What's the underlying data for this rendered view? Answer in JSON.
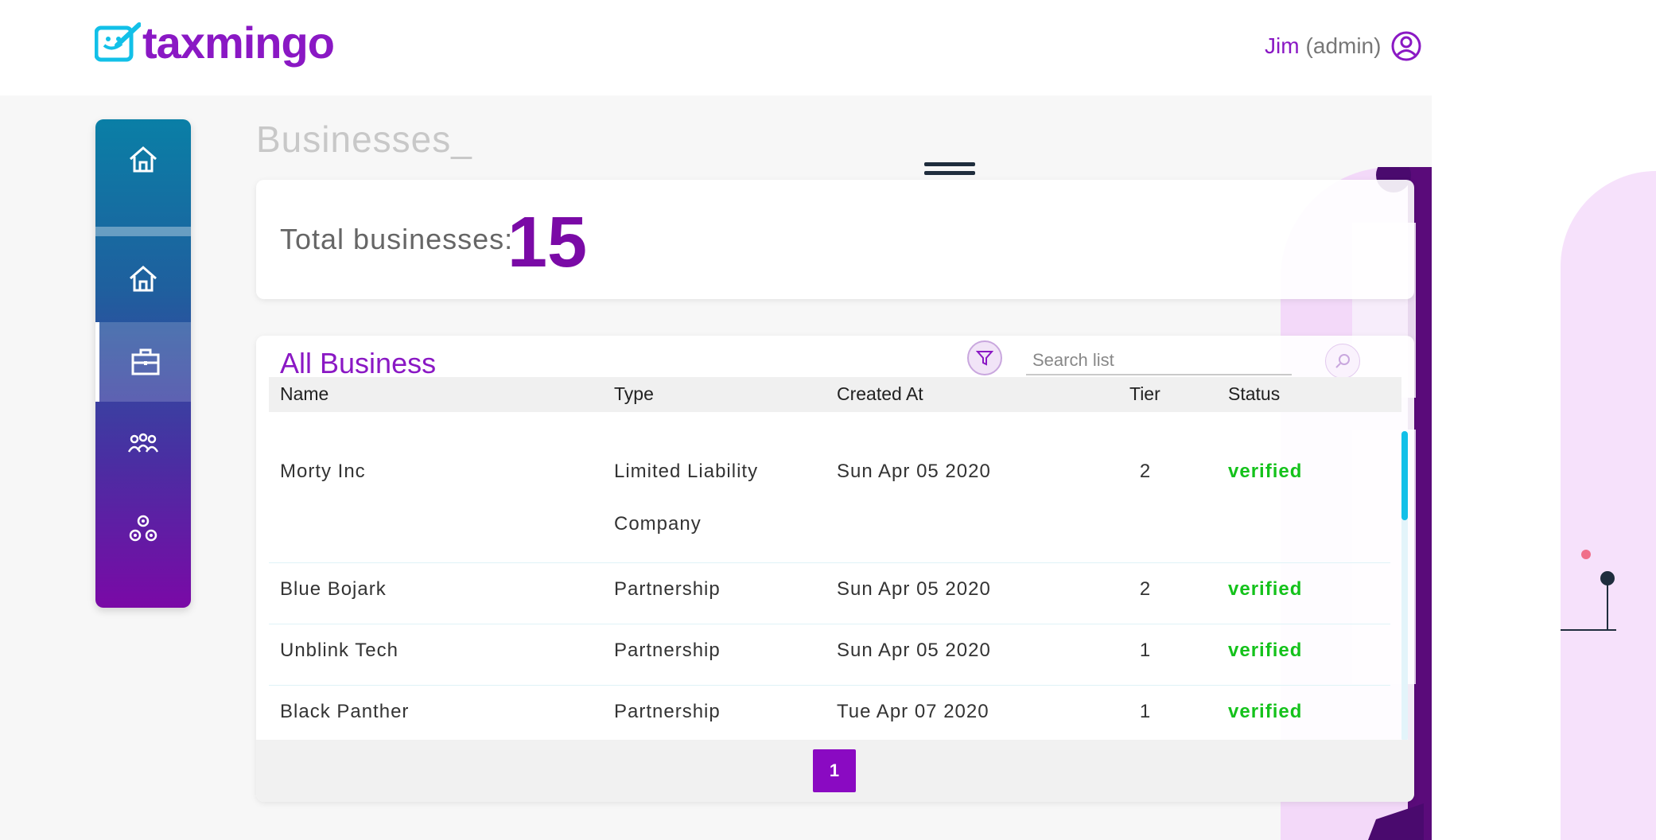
{
  "brand": {
    "name": "taxmingo",
    "accent": "#8a18c4",
    "cyan": "#12c0e8"
  },
  "user": {
    "name": "Jim",
    "role": "(admin)"
  },
  "page": {
    "title": "Businesses_"
  },
  "summary": {
    "label": "Total businesses:",
    "count": "15"
  },
  "list": {
    "title": "All Business",
    "search_placeholder": "Search list",
    "columns": {
      "name": "Name",
      "type": "Type",
      "created": "Created At",
      "tier": "Tier",
      "status": "Status"
    },
    "rows": [
      {
        "name": "Morty Inc",
        "type_line1": "Limited Liability",
        "type_line2": "Company",
        "created": "Sun Apr 05 2020",
        "tier": "2",
        "status": "verified"
      },
      {
        "name": "Blue Bojark",
        "type_line1": "Partnership",
        "created": "Sun Apr 05 2020",
        "tier": "2",
        "status": "verified"
      },
      {
        "name": "Unblink Tech",
        "type_line1": "Partnership",
        "created": "Sun Apr 05 2020",
        "tier": "1",
        "status": "verified"
      },
      {
        "name": "Black Panther",
        "type_line1": "Partnership",
        "created": "Tue Apr 07 2020",
        "tier": "1",
        "status": "verified"
      }
    ],
    "pagination": {
      "current": "1"
    }
  },
  "sidebar": {
    "items": [
      {
        "icon": "home-icon"
      },
      {
        "icon": "home-icon"
      },
      {
        "icon": "briefcase-icon"
      },
      {
        "icon": "users-icon"
      },
      {
        "icon": "gears-icon"
      }
    ]
  }
}
